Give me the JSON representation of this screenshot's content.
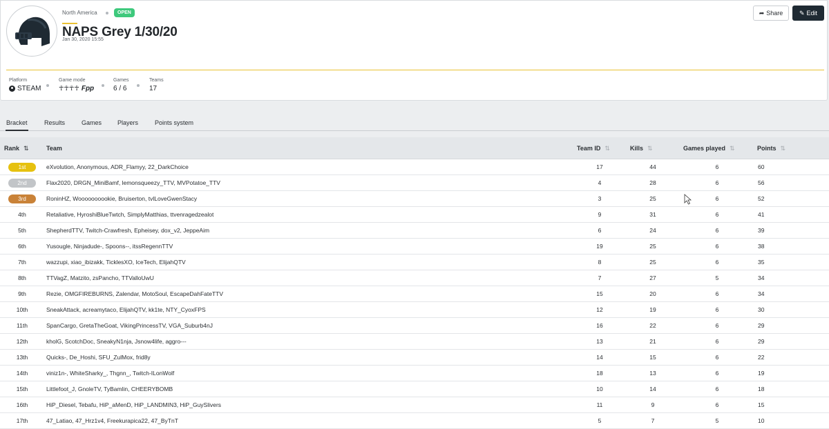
{
  "header": {
    "region": "North America",
    "status_badge": "OPEN",
    "title": "NAPS Grey 1/30/20",
    "date": "Jan 30, 2020 15:55",
    "share_label": "Share",
    "edit_label": "Edit"
  },
  "stats": {
    "platform_label": "Platform",
    "platform_value": "STEAM",
    "gamemode_label": "Game mode",
    "gamemode_icons": "☥☥☥☥",
    "gamemode_value": "Fpp",
    "games_label": "Games",
    "games_value": "6 / 6",
    "teams_label": "Teams",
    "teams_value": "17"
  },
  "tabs": [
    {
      "label": "Bracket",
      "active": true
    },
    {
      "label": "Results",
      "active": false
    },
    {
      "label": "Games",
      "active": false
    },
    {
      "label": "Players",
      "active": false
    },
    {
      "label": "Points system",
      "active": false
    }
  ],
  "table": {
    "headers": {
      "rank": "Rank",
      "team": "Team",
      "team_id": "Team ID",
      "kills": "Kills",
      "games_played": "Games played",
      "points": "Points"
    },
    "medal_colors": {
      "1st": "#e6c10f",
      "2nd": "#c2c5c8",
      "3rd": "#c98238"
    },
    "rows": [
      {
        "rank": "1st",
        "team": "eXvolution, Anonymous, ADR_Flamyy, 22_DarkChoice",
        "team_id": "17",
        "kills": "44",
        "games": "6",
        "points": "60"
      },
      {
        "rank": "2nd",
        "team": "Flax2020, DRGN_MiniBamf, lemonsqueezy_TTV, MVPotatoe_TTV",
        "team_id": "4",
        "kills": "28",
        "games": "6",
        "points": "56"
      },
      {
        "rank": "3rd",
        "team": "RoninHZ, Woooooooookie, Bruiserton, tvlLoveGwenStacy",
        "team_id": "3",
        "kills": "25",
        "games": "6",
        "points": "52"
      },
      {
        "rank": "4th",
        "team": "Retaliative, HyroshiBlueTwtch, SimplyMatthias, ttvenragedzealot",
        "team_id": "9",
        "kills": "31",
        "games": "6",
        "points": "41"
      },
      {
        "rank": "5th",
        "team": "ShepherdTTV, Twitch-Crawfresh, Epheisey, dox_v2, JeppeAim",
        "team_id": "6",
        "kills": "24",
        "games": "6",
        "points": "39"
      },
      {
        "rank": "6th",
        "team": "Yusougle, Ninjadude-, Spoons--, itssRegennTTV",
        "team_id": "19",
        "kills": "25",
        "games": "6",
        "points": "38"
      },
      {
        "rank": "7th",
        "team": "wazzupi, xiao_ibizakk, TicklesXO, IceTech, ElijahQTV",
        "team_id": "8",
        "kills": "25",
        "games": "6",
        "points": "35"
      },
      {
        "rank": "8th",
        "team": "TTVagZ, Matzito, zsPancho, TTValloUwU",
        "team_id": "7",
        "kills": "27",
        "games": "5",
        "points": "34"
      },
      {
        "rank": "9th",
        "team": "Rezie, OMGFIREBURNS, Zalendar, MotoSoul, EscapeDahFateTTV",
        "team_id": "15",
        "kills": "20",
        "games": "6",
        "points": "34"
      },
      {
        "rank": "10th",
        "team": "SneakAttack, acreamytaco, ElijahQTV, kk1te, NTY_CyoxFPS",
        "team_id": "12",
        "kills": "19",
        "games": "6",
        "points": "30"
      },
      {
        "rank": "11th",
        "team": "SpanCargo, GretaTheGoat, VikingPrincessTV, VGA_Suburb4nJ",
        "team_id": "16",
        "kills": "22",
        "games": "6",
        "points": "29"
      },
      {
        "rank": "12th",
        "team": "kholG, ScotchDoc, SneakyN1nja, Jsnow4life, aggro---",
        "team_id": "13",
        "kills": "21",
        "games": "6",
        "points": "29"
      },
      {
        "rank": "13th",
        "team": "Quicks-, De_Hoshi, SFU_ZulMox, frid8y",
        "team_id": "14",
        "kills": "15",
        "games": "6",
        "points": "22"
      },
      {
        "rank": "14th",
        "team": "viniz1n-, WhiteSharky_, Thgnn_, Twitch-ILonWolf",
        "team_id": "18",
        "kills": "13",
        "games": "6",
        "points": "19"
      },
      {
        "rank": "15th",
        "team": "Littlefoot_J, GnoleTV, TyBamlin, CHEERYBOMB",
        "team_id": "10",
        "kills": "14",
        "games": "6",
        "points": "18"
      },
      {
        "rank": "16th",
        "team": "HiP_Diesel, Tebafu, HiP_aMenD, HiP_LANDMIN3, HiP_GuySlivers",
        "team_id": "11",
        "kills": "9",
        "games": "6",
        "points": "15"
      },
      {
        "rank": "17th",
        "team": "47_Latiao, 47_Hrz1v4, Freekurapica22, 47_ByTnT",
        "team_id": "5",
        "kills": "7",
        "games": "5",
        "points": "10"
      }
    ]
  },
  "colors": {
    "accent_yellow": "#e9c132",
    "open_green": "#3ec97c",
    "edit_dark": "#1f2a33"
  }
}
